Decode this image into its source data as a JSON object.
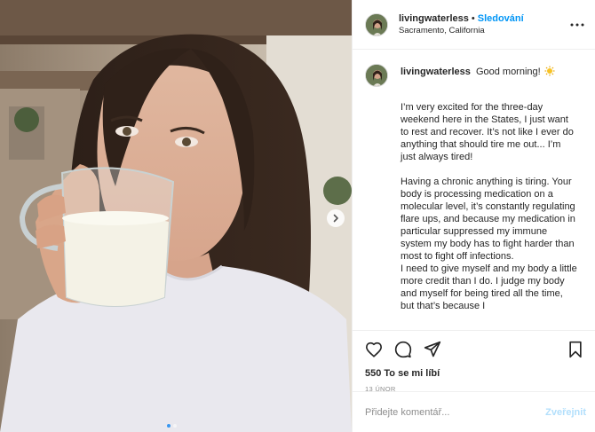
{
  "post": {
    "username": "livingwaterless",
    "follow_label": "Sledování",
    "location": "Sacramento, California",
    "more_icon": "more-horizontal-icon",
    "slide_dots": 2,
    "active_slide": 1
  },
  "caption": {
    "username": "livingwaterless",
    "first_line": "Good morning!",
    "emoji": "sun-icon",
    "paragraphs": [
      "I’m very excited for the three-day weekend here in the States, I just want to rest and recover. It’s not like I ever do anything that should tire me out... I’m just always tired!",
      "Having a chronic anything is tiring. Your body is processing medication on a molecular level, it’s constantly regulating flare ups, and because my medication in particular suppressed my immune system my body has to fight harder than most to fight off infections.",
      "I need to give myself and my body a little more credit than I do. I judge my body and myself for being tired all the time, but that’s because I"
    ]
  },
  "actions": {
    "like_icon": "heart-icon",
    "comment_icon": "comment-icon",
    "share_icon": "paper-plane-icon",
    "save_icon": "bookmark-icon"
  },
  "likes_text": "550 To se mi líbí",
  "date_text": "13 ÚNOR",
  "comment_box": {
    "placeholder": "Přidejte komentář...",
    "post_label": "Zveřejnit"
  },
  "colors": {
    "accent": "#0095f6",
    "post_disabled": "#b2dffc",
    "muted": "#8e8e8e",
    "border": "#efefef"
  }
}
